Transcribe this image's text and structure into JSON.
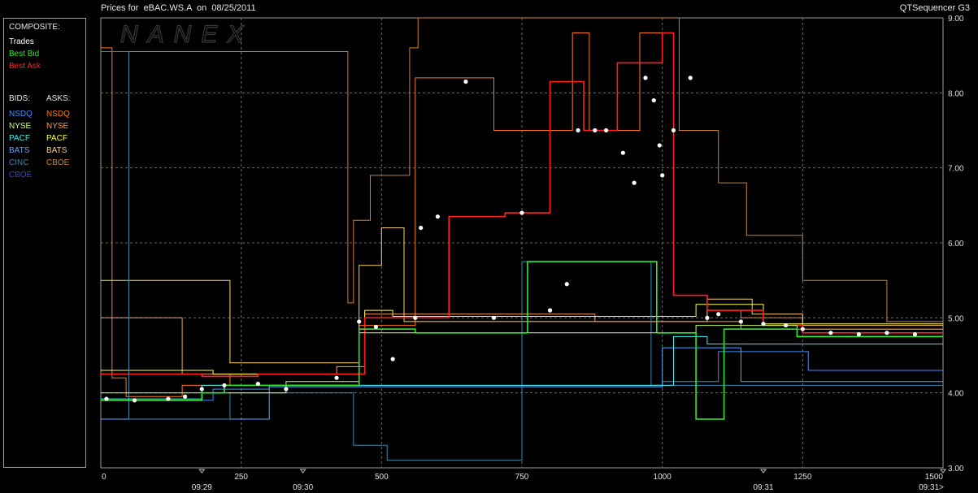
{
  "header": {
    "title": "Prices for  eBAC.WS.A  on  08/25/2011",
    "app": "QTSequencer G3"
  },
  "watermark": "NANEX",
  "legend": {
    "composite_label": "COMPOSITE:",
    "composite": [
      {
        "label": "Trades",
        "color": "#ffffff"
      },
      {
        "label": "Best Bid",
        "color": "#2ee82e"
      },
      {
        "label": "Best Ask",
        "color": "#ff2020"
      }
    ],
    "bids_label": "BIDS:",
    "asks_label": "ASKS:",
    "bids": [
      {
        "label": "NSDQ",
        "color": "#3f8cff"
      },
      {
        "label": "NYSE",
        "color": "#c8ff80"
      },
      {
        "label": "PACF",
        "color": "#3ff0f0"
      },
      {
        "label": "BATS",
        "color": "#5aa8ff"
      },
      {
        "label": "CINC",
        "color": "#3a8ab0"
      },
      {
        "label": "CBOE",
        "color": "#2850c8"
      }
    ],
    "asks": [
      {
        "label": "NSDQ",
        "color": "#ff7a1a"
      },
      {
        "label": "NYSE",
        "color": "#ff9a5a"
      },
      {
        "label": "PACF",
        "color": "#ffff40"
      },
      {
        "label": "BATS",
        "color": "#ffd070"
      },
      {
        "label": "CBOE",
        "color": "#d08030"
      }
    ]
  },
  "chart_data": {
    "type": "line",
    "xlim": [
      0,
      1500
    ],
    "ylim": [
      3.0,
      9.0
    ],
    "x_ticks": [
      "0",
      "250",
      "500",
      "750",
      "1000",
      "1250",
      "1500"
    ],
    "y_ticks": [
      "3.00",
      "4.00",
      "5.00",
      "6.00",
      "7.00",
      "8.00",
      "9.00"
    ],
    "time_ticks": [
      {
        "x": 180,
        "label": "09:29"
      },
      {
        "x": 360,
        "label": "09:30"
      },
      {
        "x": 1180,
        "label": "09:31"
      },
      {
        "x": 1500,
        "label": "09:31>"
      }
    ],
    "grid": true,
    "series": [
      {
        "name": "NSDQ",
        "side": "ask",
        "color": "#ff7a1a",
        "steps": [
          [
            0,
            8.6
          ],
          [
            20,
            8.6
          ],
          [
            20,
            4.2
          ],
          [
            45,
            4.2
          ],
          [
            45,
            3.95
          ],
          [
            145,
            3.95
          ],
          [
            145,
            4.1
          ],
          [
            230,
            4.1
          ],
          [
            230,
            4.25
          ],
          [
            460,
            4.25
          ],
          [
            460,
            4.9
          ],
          [
            560,
            4.9
          ],
          [
            560,
            8.2
          ],
          [
            700,
            8.2
          ],
          [
            700,
            7.5
          ],
          [
            840,
            7.5
          ],
          [
            840,
            8.8
          ],
          [
            870,
            8.8
          ],
          [
            870,
            7.5
          ],
          [
            960,
            7.5
          ],
          [
            960,
            8.8
          ],
          [
            1020,
            8.8
          ],
          [
            1020,
            5.3
          ],
          [
            1080,
            5.3
          ],
          [
            1080,
            5.1
          ],
          [
            1140,
            5.1
          ],
          [
            1140,
            5.0
          ],
          [
            1250,
            5.0
          ],
          [
            1250,
            4.85
          ],
          [
            1500,
            4.85
          ]
        ]
      },
      {
        "name": "CBOE",
        "side": "ask",
        "color": "#d08030",
        "steps": [
          [
            0,
            8.55
          ],
          [
            440,
            8.55
          ],
          [
            440,
            5.2
          ],
          [
            450,
            5.2
          ],
          [
            450,
            6.3
          ],
          [
            480,
            6.3
          ],
          [
            480,
            6.9
          ],
          [
            550,
            6.9
          ],
          [
            550,
            8.6
          ],
          [
            565,
            8.6
          ],
          [
            565,
            9.0
          ],
          [
            1030,
            9.0
          ],
          [
            1030,
            7.5
          ],
          [
            1100,
            7.5
          ],
          [
            1100,
            6.8
          ],
          [
            1150,
            6.8
          ],
          [
            1150,
            6.1
          ],
          [
            1250,
            6.1
          ],
          [
            1250,
            5.5
          ],
          [
            1400,
            5.5
          ],
          [
            1400,
            4.95
          ],
          [
            1500,
            4.95
          ]
        ]
      },
      {
        "name": "BATS",
        "side": "ask",
        "color": "#ffd070",
        "steps": [
          [
            0,
            5.5
          ],
          [
            230,
            5.5
          ],
          [
            230,
            4.4
          ],
          [
            460,
            4.4
          ],
          [
            460,
            5.7
          ],
          [
            500,
            5.7
          ],
          [
            500,
            6.2
          ],
          [
            540,
            6.2
          ],
          [
            540,
            4.95
          ],
          [
            1080,
            4.95
          ],
          [
            1080,
            5.25
          ],
          [
            1160,
            5.25
          ],
          [
            1160,
            5.05
          ],
          [
            1250,
            5.05
          ],
          [
            1250,
            4.9
          ],
          [
            1500,
            4.9
          ]
        ]
      },
      {
        "name": "NYSE",
        "side": "ask",
        "color": "#ff9a5a",
        "steps": [
          [
            0,
            5.0
          ],
          [
            145,
            5.0
          ],
          [
            145,
            4.25
          ],
          [
            420,
            4.25
          ],
          [
            420,
            4.35
          ],
          [
            470,
            4.35
          ],
          [
            470,
            5.05
          ],
          [
            880,
            5.05
          ],
          [
            880,
            4.95
          ],
          [
            1140,
            4.95
          ],
          [
            1140,
            4.85
          ],
          [
            1500,
            4.85
          ]
        ]
      },
      {
        "name": "PACF",
        "side": "ask",
        "color": "#ffff40",
        "steps": [
          [
            0,
            4.3
          ],
          [
            200,
            4.3
          ],
          [
            200,
            4.25
          ],
          [
            470,
            4.25
          ],
          [
            470,
            5.1
          ],
          [
            520,
            5.1
          ],
          [
            520,
            5.02
          ],
          [
            1060,
            5.02
          ],
          [
            1060,
            5.18
          ],
          [
            1180,
            5.18
          ],
          [
            1180,
            4.92
          ],
          [
            1500,
            4.92
          ]
        ]
      },
      {
        "name": "Best Ask",
        "side": "composite",
        "color": "#ff2020",
        "steps": [
          [
            0,
            4.25
          ],
          [
            180,
            4.25
          ],
          [
            180,
            4.22
          ],
          [
            280,
            4.22
          ],
          [
            280,
            4.25
          ],
          [
            470,
            4.25
          ],
          [
            470,
            5.0
          ],
          [
            620,
            5.0
          ],
          [
            620,
            6.35
          ],
          [
            720,
            6.35
          ],
          [
            720,
            6.4
          ],
          [
            800,
            6.4
          ],
          [
            800,
            8.15
          ],
          [
            860,
            8.15
          ],
          [
            860,
            7.5
          ],
          [
            920,
            7.5
          ],
          [
            920,
            8.4
          ],
          [
            1000,
            8.4
          ],
          [
            1000,
            8.8
          ],
          [
            1020,
            8.8
          ],
          [
            1020,
            5.3
          ],
          [
            1080,
            5.3
          ],
          [
            1080,
            5.1
          ],
          [
            1180,
            5.1
          ],
          [
            1180,
            4.9
          ],
          [
            1250,
            4.9
          ],
          [
            1250,
            4.8
          ],
          [
            1500,
            4.8
          ]
        ]
      },
      {
        "name": "NSDQ",
        "side": "bid",
        "color": "#3f8cff",
        "steps": [
          [
            0,
            3.9
          ],
          [
            200,
            3.9
          ],
          [
            200,
            4.05
          ],
          [
            300,
            4.05
          ],
          [
            300,
            4.1
          ],
          [
            600,
            4.1
          ],
          [
            600,
            4.1
          ],
          [
            1000,
            4.1
          ],
          [
            1000,
            4.15
          ],
          [
            1100,
            4.15
          ],
          [
            1100,
            4.55
          ],
          [
            1260,
            4.55
          ],
          [
            1260,
            4.3
          ],
          [
            1500,
            4.3
          ]
        ]
      },
      {
        "name": "BATS",
        "side": "bid",
        "color": "#5aa8ff",
        "steps": [
          [
            0,
            3.65
          ],
          [
            300,
            3.65
          ],
          [
            300,
            4.08
          ],
          [
            1000,
            4.08
          ],
          [
            1000,
            4.6
          ],
          [
            1140,
            4.6
          ],
          [
            1140,
            4.15
          ],
          [
            1500,
            4.15
          ]
        ]
      },
      {
        "name": "CINC",
        "side": "bid",
        "color": "#3a8ab0",
        "steps": [
          [
            0,
            8.55
          ],
          [
            50,
            8.55
          ],
          [
            50,
            3.65
          ],
          [
            230,
            3.65
          ],
          [
            230,
            4.0
          ],
          [
            450,
            4.0
          ],
          [
            450,
            3.3
          ],
          [
            510,
            3.3
          ],
          [
            510,
            3.1
          ],
          [
            750,
            3.1
          ],
          [
            750,
            5.75
          ],
          [
            980,
            5.75
          ],
          [
            980,
            4.1
          ],
          [
            1500,
            4.1
          ]
        ]
      },
      {
        "name": "PACF",
        "side": "bid",
        "color": "#3ff0f0",
        "steps": [
          [
            0,
            3.92
          ],
          [
            180,
            3.92
          ],
          [
            180,
            4.1
          ],
          [
            1020,
            4.1
          ],
          [
            1020,
            4.75
          ],
          [
            1080,
            4.75
          ],
          [
            1080,
            4.65
          ],
          [
            1500,
            4.65
          ]
        ]
      },
      {
        "name": "NYSE",
        "side": "bid",
        "color": "#c8ff80",
        "steps": [
          [
            0,
            4.0
          ],
          [
            330,
            4.0
          ],
          [
            330,
            4.15
          ],
          [
            460,
            4.15
          ],
          [
            460,
            4.8
          ],
          [
            1060,
            4.8
          ],
          [
            1060,
            4.9
          ],
          [
            1240,
            4.9
          ],
          [
            1240,
            4.75
          ],
          [
            1500,
            4.75
          ]
        ]
      },
      {
        "name": "Best Bid",
        "side": "composite",
        "color": "#2ee82e",
        "steps": [
          [
            0,
            3.9
          ],
          [
            180,
            3.9
          ],
          [
            180,
            4.0
          ],
          [
            220,
            4.0
          ],
          [
            220,
            4.1
          ],
          [
            460,
            4.1
          ],
          [
            460,
            4.85
          ],
          [
            560,
            4.85
          ],
          [
            560,
            4.8
          ],
          [
            760,
            4.8
          ],
          [
            760,
            5.75
          ],
          [
            990,
            5.75
          ],
          [
            990,
            4.8
          ],
          [
            1060,
            4.8
          ],
          [
            1060,
            3.65
          ],
          [
            1110,
            3.65
          ],
          [
            1110,
            4.85
          ],
          [
            1240,
            4.85
          ],
          [
            1240,
            4.75
          ],
          [
            1500,
            4.75
          ]
        ]
      }
    ],
    "trades": [
      [
        10,
        3.92
      ],
      [
        60,
        3.9
      ],
      [
        120,
        3.92
      ],
      [
        150,
        3.95
      ],
      [
        180,
        4.05
      ],
      [
        220,
        4.1
      ],
      [
        280,
        4.12
      ],
      [
        330,
        4.05
      ],
      [
        420,
        4.2
      ],
      [
        460,
        4.95
      ],
      [
        490,
        4.88
      ],
      [
        520,
        4.45
      ],
      [
        560,
        5.0
      ],
      [
        570,
        6.2
      ],
      [
        600,
        6.35
      ],
      [
        650,
        8.15
      ],
      [
        700,
        5.0
      ],
      [
        750,
        6.4
      ],
      [
        800,
        5.1
      ],
      [
        830,
        5.45
      ],
      [
        850,
        7.5
      ],
      [
        880,
        7.5
      ],
      [
        900,
        7.5
      ],
      [
        930,
        7.2
      ],
      [
        950,
        6.8
      ],
      [
        970,
        8.2
      ],
      [
        985,
        7.9
      ],
      [
        995,
        7.3
      ],
      [
        1000,
        6.9
      ],
      [
        1020,
        7.5
      ],
      [
        1050,
        8.2
      ],
      [
        1080,
        5.0
      ],
      [
        1100,
        5.05
      ],
      [
        1140,
        4.95
      ],
      [
        1180,
        4.92
      ],
      [
        1220,
        4.9
      ],
      [
        1250,
        4.85
      ],
      [
        1300,
        4.8
      ],
      [
        1350,
        4.78
      ],
      [
        1400,
        4.8
      ],
      [
        1450,
        4.78
      ]
    ]
  }
}
